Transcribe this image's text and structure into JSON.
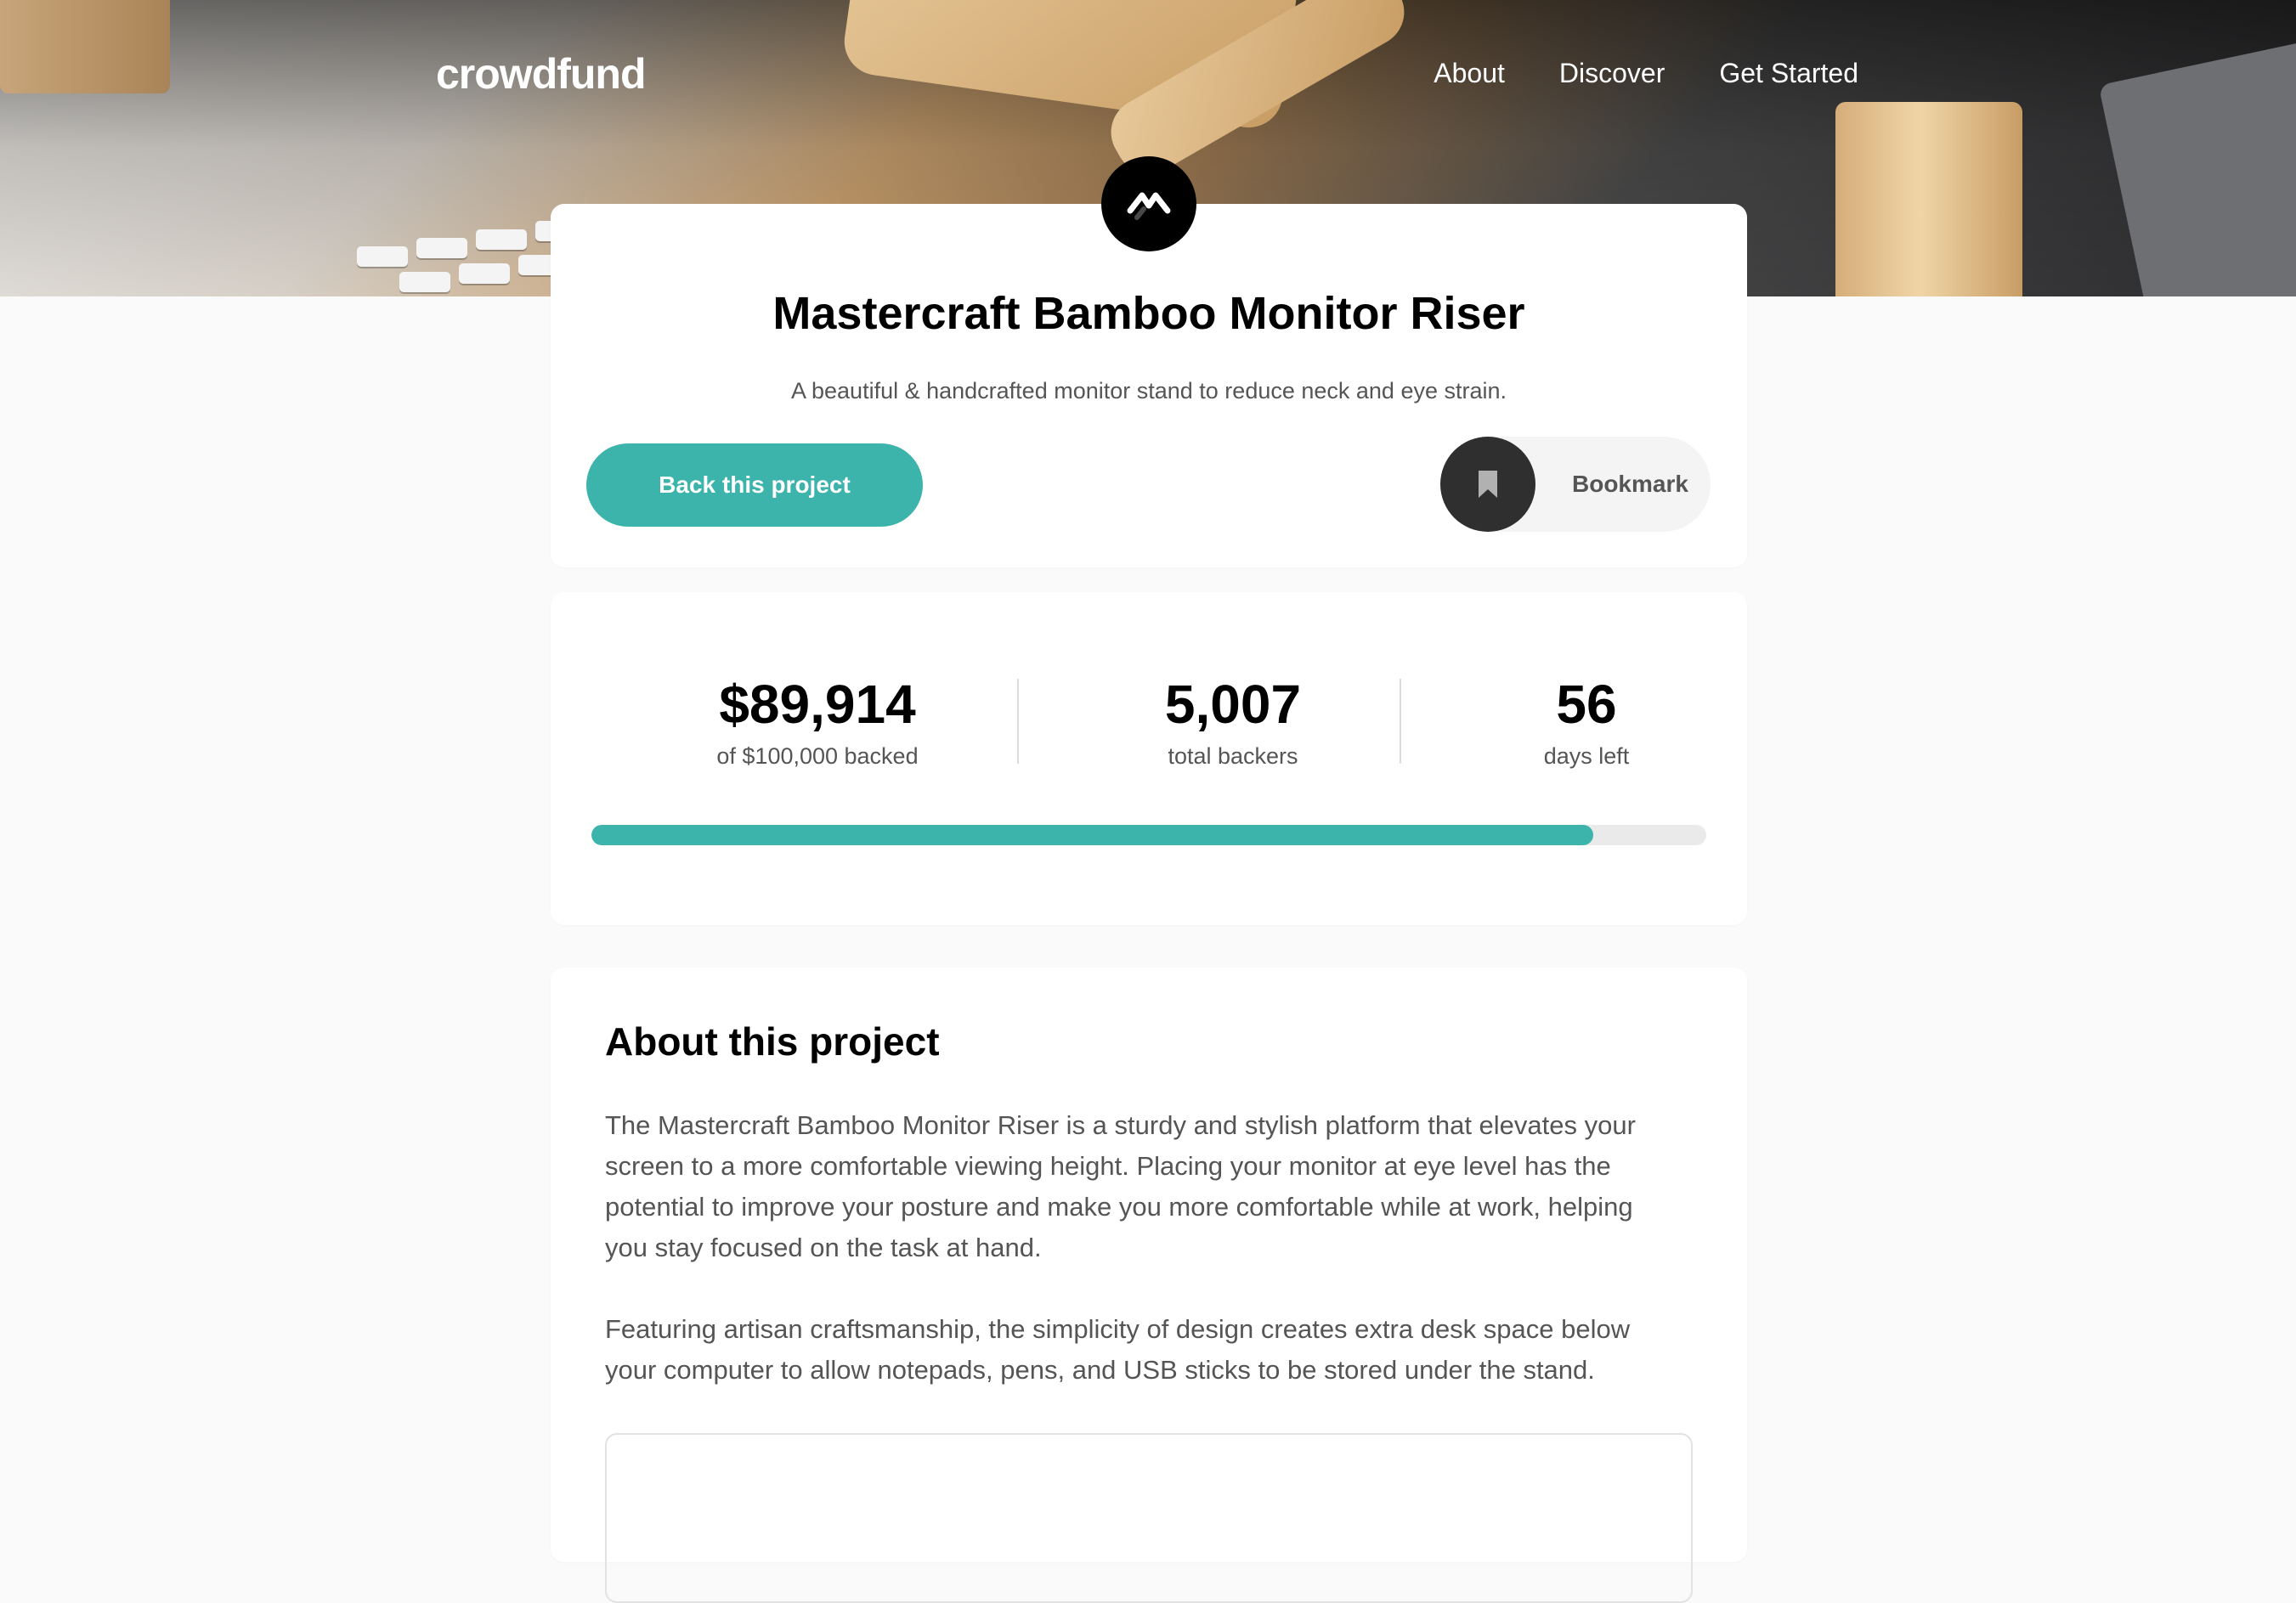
{
  "nav": {
    "logo": "crowdfund",
    "links": [
      "About",
      "Discover",
      "Get Started"
    ]
  },
  "project": {
    "title": "Mastercraft Bamboo Monitor Riser",
    "description": "A beautiful & handcrafted monitor stand to reduce neck and eye strain.",
    "back_label": "Back this project",
    "bookmark_label": "Bookmark"
  },
  "stats": {
    "backed_amount": "$89,914",
    "backed_label": "of $100,000 backed",
    "backers": "5,007",
    "backers_label": "total backers",
    "days": "56",
    "days_label": "days left",
    "progress_fraction": 0.899
  },
  "about": {
    "heading": "About this project",
    "paragraph1": "The Mastercraft Bamboo Monitor Riser is a sturdy and stylish platform that elevates your screen to a more comfortable viewing height. Placing your monitor at eye level has the potential to improve your posture and make you more comfortable while at work, helping you stay focused on the task at hand.",
    "paragraph2": "Featuring artisan craftsmanship, the simplicity of design creates extra desk space below your computer to allow notepads, pens, and USB sticks to be stored under the stand."
  },
  "colors": {
    "accent": "#3cb3ab",
    "dark": "#2f2f2f",
    "muted_text": "#555555"
  },
  "icons": [
    "mastercraft-logo-icon",
    "bookmark-icon"
  ]
}
